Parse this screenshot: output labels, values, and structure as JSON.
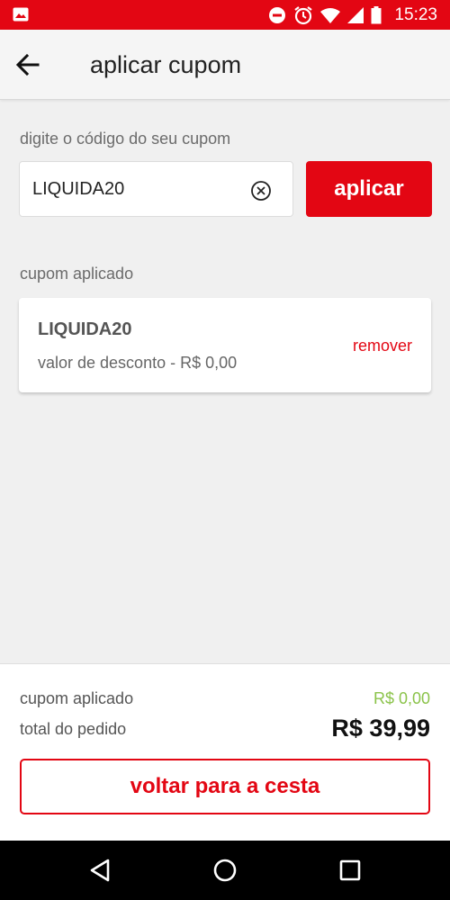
{
  "status_bar": {
    "time": "15:23",
    "color": "#e30613",
    "icons": [
      "image-icon",
      "do-not-disturb-icon",
      "alarm-icon",
      "wifi-icon",
      "cell-signal-icon",
      "battery-icon"
    ]
  },
  "app_bar": {
    "title": "aplicar cupom",
    "back_icon": "arrow-left-icon"
  },
  "coupon_form": {
    "label": "digite o código do seu cupom",
    "input_value": "LIQUIDA20",
    "clear_icon": "circle-x-icon",
    "apply_label": "aplicar"
  },
  "applied_coupon": {
    "section_label": "cupom aplicado",
    "code": "LIQUIDA20",
    "description": "valor de desconto - R$ 0,00",
    "remove_label": "remover"
  },
  "summary": {
    "coupon_label": "cupom aplicado",
    "coupon_value": "R$ 0,00",
    "total_label": "total do pedido",
    "total_value": "R$ 39,99",
    "back_button_label": "voltar para a cesta"
  },
  "nav_bar": {
    "icons": [
      "triangle-back-icon",
      "circle-home-icon",
      "square-recents-icon"
    ]
  },
  "colors": {
    "accent": "#e30613",
    "discount": "#8bc34a"
  }
}
